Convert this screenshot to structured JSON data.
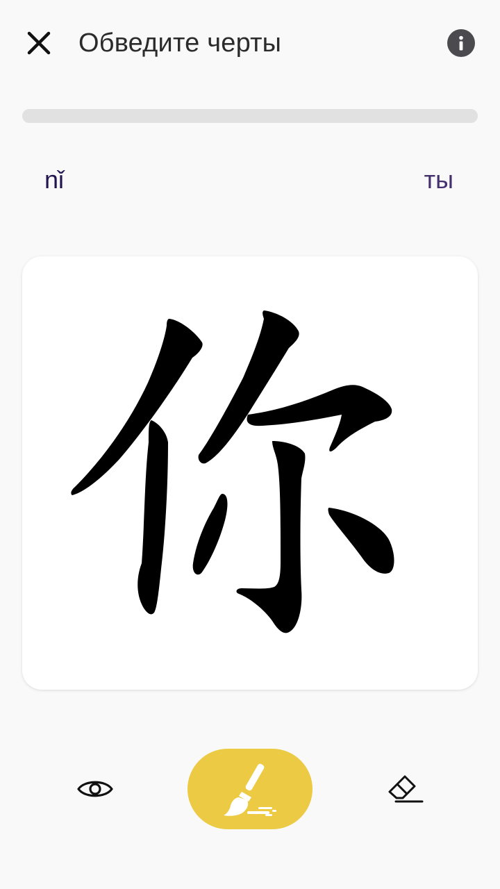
{
  "header": {
    "title": "Обведите черты"
  },
  "progress": {
    "value": 0
  },
  "word": {
    "pinyin": "nǐ",
    "translation": "ты"
  },
  "toolbar": {
    "tools": [
      "eye-icon",
      "brush-icon",
      "eraser-icon"
    ],
    "active_tool": "brush-icon"
  },
  "colors": {
    "background": "#f9f9f9",
    "accent": "#ecca43",
    "pinyin": "#23154f",
    "translation": "#44306f",
    "stroke": "#000000"
  }
}
